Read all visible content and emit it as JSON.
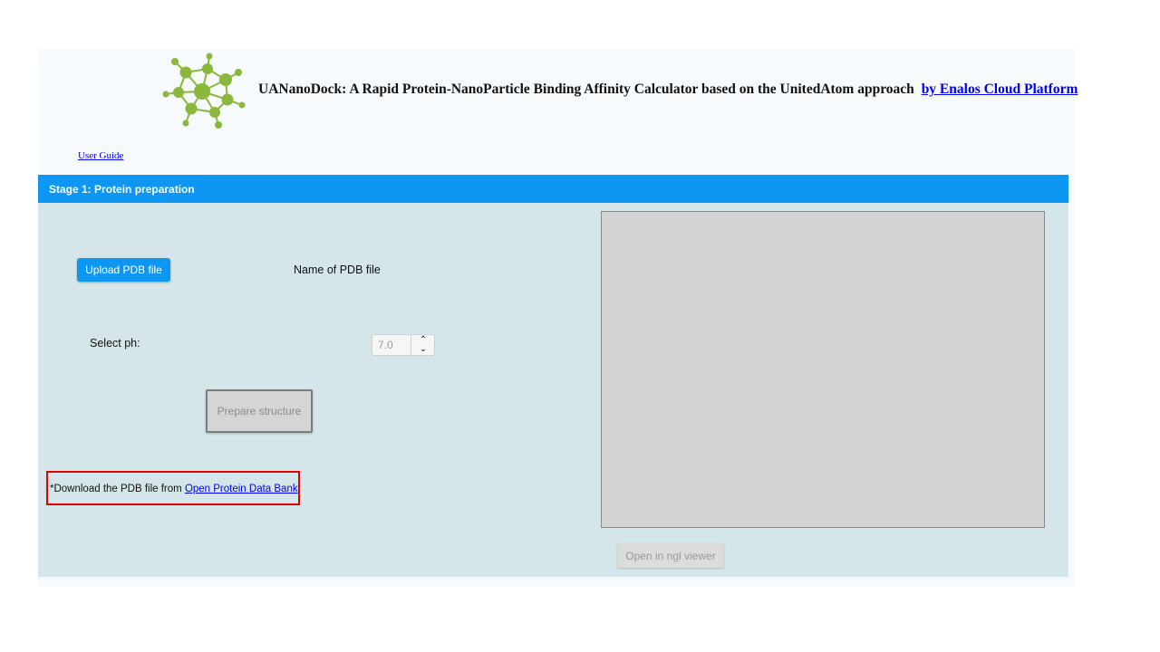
{
  "header": {
    "title": "UANanoDock: A Rapid Protein-NanoParticle Binding Affinity Calculator based on the UnitedAtom approach",
    "platform_link": "by Enalos Cloud Platform",
    "logo_icon": "nanoparticle-network-logo",
    "logo_color": "#8ab83a"
  },
  "nav": {
    "user_guide": "User Guide"
  },
  "stage": {
    "title": "Stage 1: Protein preparation",
    "color": "#0d97f3"
  },
  "form": {
    "upload_label": "Upload PDB file",
    "pdb_name_label": "Name of PDB file",
    "ph_label": "Select ph:",
    "ph_value": "7.0",
    "spin_up_icon": "chevron-up-icon",
    "spin_down_icon": "chevron-down-icon",
    "prepare_label": "Prepare structure"
  },
  "download_note": {
    "prefix": "*Download the PDB file from ",
    "link": "Open Protein Data Bank",
    "highlight_color": "#e00000"
  },
  "viewer": {
    "open_label": "Open in ngl viewer"
  }
}
